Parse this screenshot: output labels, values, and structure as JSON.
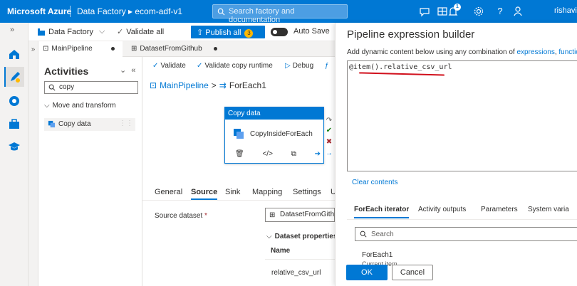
{
  "topbar": {
    "brand": "Microsoft Azure",
    "breadcrumb": "Data Factory ▸ ecom-adf-v1",
    "search_placeholder": "Search factory and documentation",
    "notification_count": "1",
    "user": "rishavi"
  },
  "factory_toolbar": {
    "factory_label": "Data Factory",
    "validate_all": "Validate all",
    "publish_all": "Publish all",
    "publish_count": "3",
    "auto_save": "Auto Save"
  },
  "tabs": [
    {
      "label": "MainPipeline"
    },
    {
      "label": "DatasetFromGithub"
    }
  ],
  "activities": {
    "title": "Activities",
    "search_value": "copy",
    "category": "Move and transform",
    "item": "Copy data"
  },
  "canvas_toolbar": {
    "validate": "Validate",
    "validate_copy_runtime": "Validate copy runtime",
    "debug": "Debug"
  },
  "breadcrumb": {
    "pipeline": "MainPipeline",
    "sep": ">",
    "foreach": "ForEach1"
  },
  "activity_card": {
    "header": "Copy data",
    "name": "CopyInsideForEach"
  },
  "properties": {
    "tabs": [
      "General",
      "Source",
      "Sink",
      "Mapping",
      "Settings",
      "U"
    ],
    "active_tab": "Source",
    "source_dataset_label": "Source dataset",
    "required_mark": "*",
    "source_dataset_value": "DatasetFromGithu",
    "dataset_properties": "Dataset properties",
    "name_col": "Name",
    "param_name": "relative_csv_url"
  },
  "builder": {
    "title": "Pipeline expression builder",
    "subtitle_prefix": "Add dynamic content below using any combination of ",
    "link_expressions": "expressions",
    "comma": ", ",
    "link_functions": "functions a",
    "expression": "@item().relative_csv_url",
    "clear_contents": "Clear contents",
    "tabs": [
      "ForEach iterator",
      "Activity outputs",
      "Parameters",
      "System varia"
    ],
    "search_placeholder": "Search",
    "iterator_name": "ForEach1",
    "iterator_desc": "Current item",
    "ok": "OK",
    "cancel": "Cancel"
  },
  "colors": {
    "accent": "#0078d4",
    "publish_badge": "#ffb900",
    "annotation_underline": "#d1101c"
  }
}
